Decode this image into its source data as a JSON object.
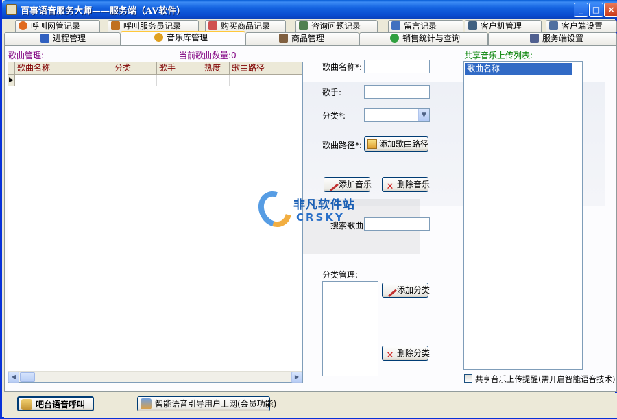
{
  "window": {
    "title": "百事语音服务大师——服务端（AV软件）",
    "controls": {
      "minimize": "_",
      "maximize": "□",
      "close": "×"
    }
  },
  "tabs_row1": [
    {
      "label": "呼叫网管记录",
      "icon": "person-icon",
      "color": "#e06a20"
    },
    {
      "label": "呼叫服务员记录",
      "icon": "waiter-icon",
      "color": "#c07020"
    },
    {
      "label": "购买商品记录",
      "icon": "cart-icon",
      "color": "#d05050"
    },
    {
      "label": "咨询问题记录",
      "icon": "chat-icon",
      "color": "#508050"
    },
    {
      "label": "留言记录",
      "icon": "note-icon",
      "color": "#4070c0"
    },
    {
      "label": "客户机管理",
      "icon": "computer-icon",
      "color": "#406080"
    },
    {
      "label": "客户端设置",
      "icon": "settings-icon",
      "color": "#5070a0"
    }
  ],
  "tabs_row2": [
    {
      "label": "进程管理",
      "icon": "check-icon",
      "color": "#3060c0",
      "active": false
    },
    {
      "label": "音乐库管理",
      "icon": "music-icon",
      "color": "#e0a020",
      "active": true
    },
    {
      "label": "商品管理",
      "icon": "goods-icon",
      "color": "#806040",
      "active": false
    },
    {
      "label": "销售统计与查询",
      "icon": "stats-icon",
      "color": "#30a040",
      "active": false
    },
    {
      "label": "服务端设置",
      "icon": "tools-icon",
      "color": "#506090",
      "active": false
    }
  ],
  "song_panel": {
    "title": "歌曲管理:",
    "count_label": "当前歌曲数量:0",
    "columns": [
      "歌曲名称",
      "分类",
      "歌手",
      "热度",
      "歌曲路径"
    ],
    "row_indicator": "▶"
  },
  "form": {
    "song_name_label": "歌曲名称*:",
    "song_name_value": "",
    "singer_label": "歌手:",
    "singer_value": "",
    "category_label": "分类*:",
    "category_value": "",
    "path_label": "歌曲路径*:",
    "add_path_button": "添加歌曲路径",
    "add_music_button": "添加音乐",
    "delete_music_button": "删除音乐",
    "search_label": "搜索歌曲:",
    "search_value": "",
    "category_mgmt_label": "分类管理:",
    "add_category_button": "添加分类",
    "delete_category_button": "删除分类"
  },
  "shared": {
    "title": "共享音乐上传列表:",
    "items": [
      "歌曲名称"
    ],
    "checkbox_label": "共享音乐上传提醒(需开启智能语音技术)",
    "checked": false
  },
  "bottom": {
    "voice_call_button": "吧台语音呼叫",
    "guide_button": "智能语音引导用户上网(会员功能)"
  },
  "watermark": {
    "text_cn": "非凡软件站",
    "text_en": "CRSKY"
  }
}
